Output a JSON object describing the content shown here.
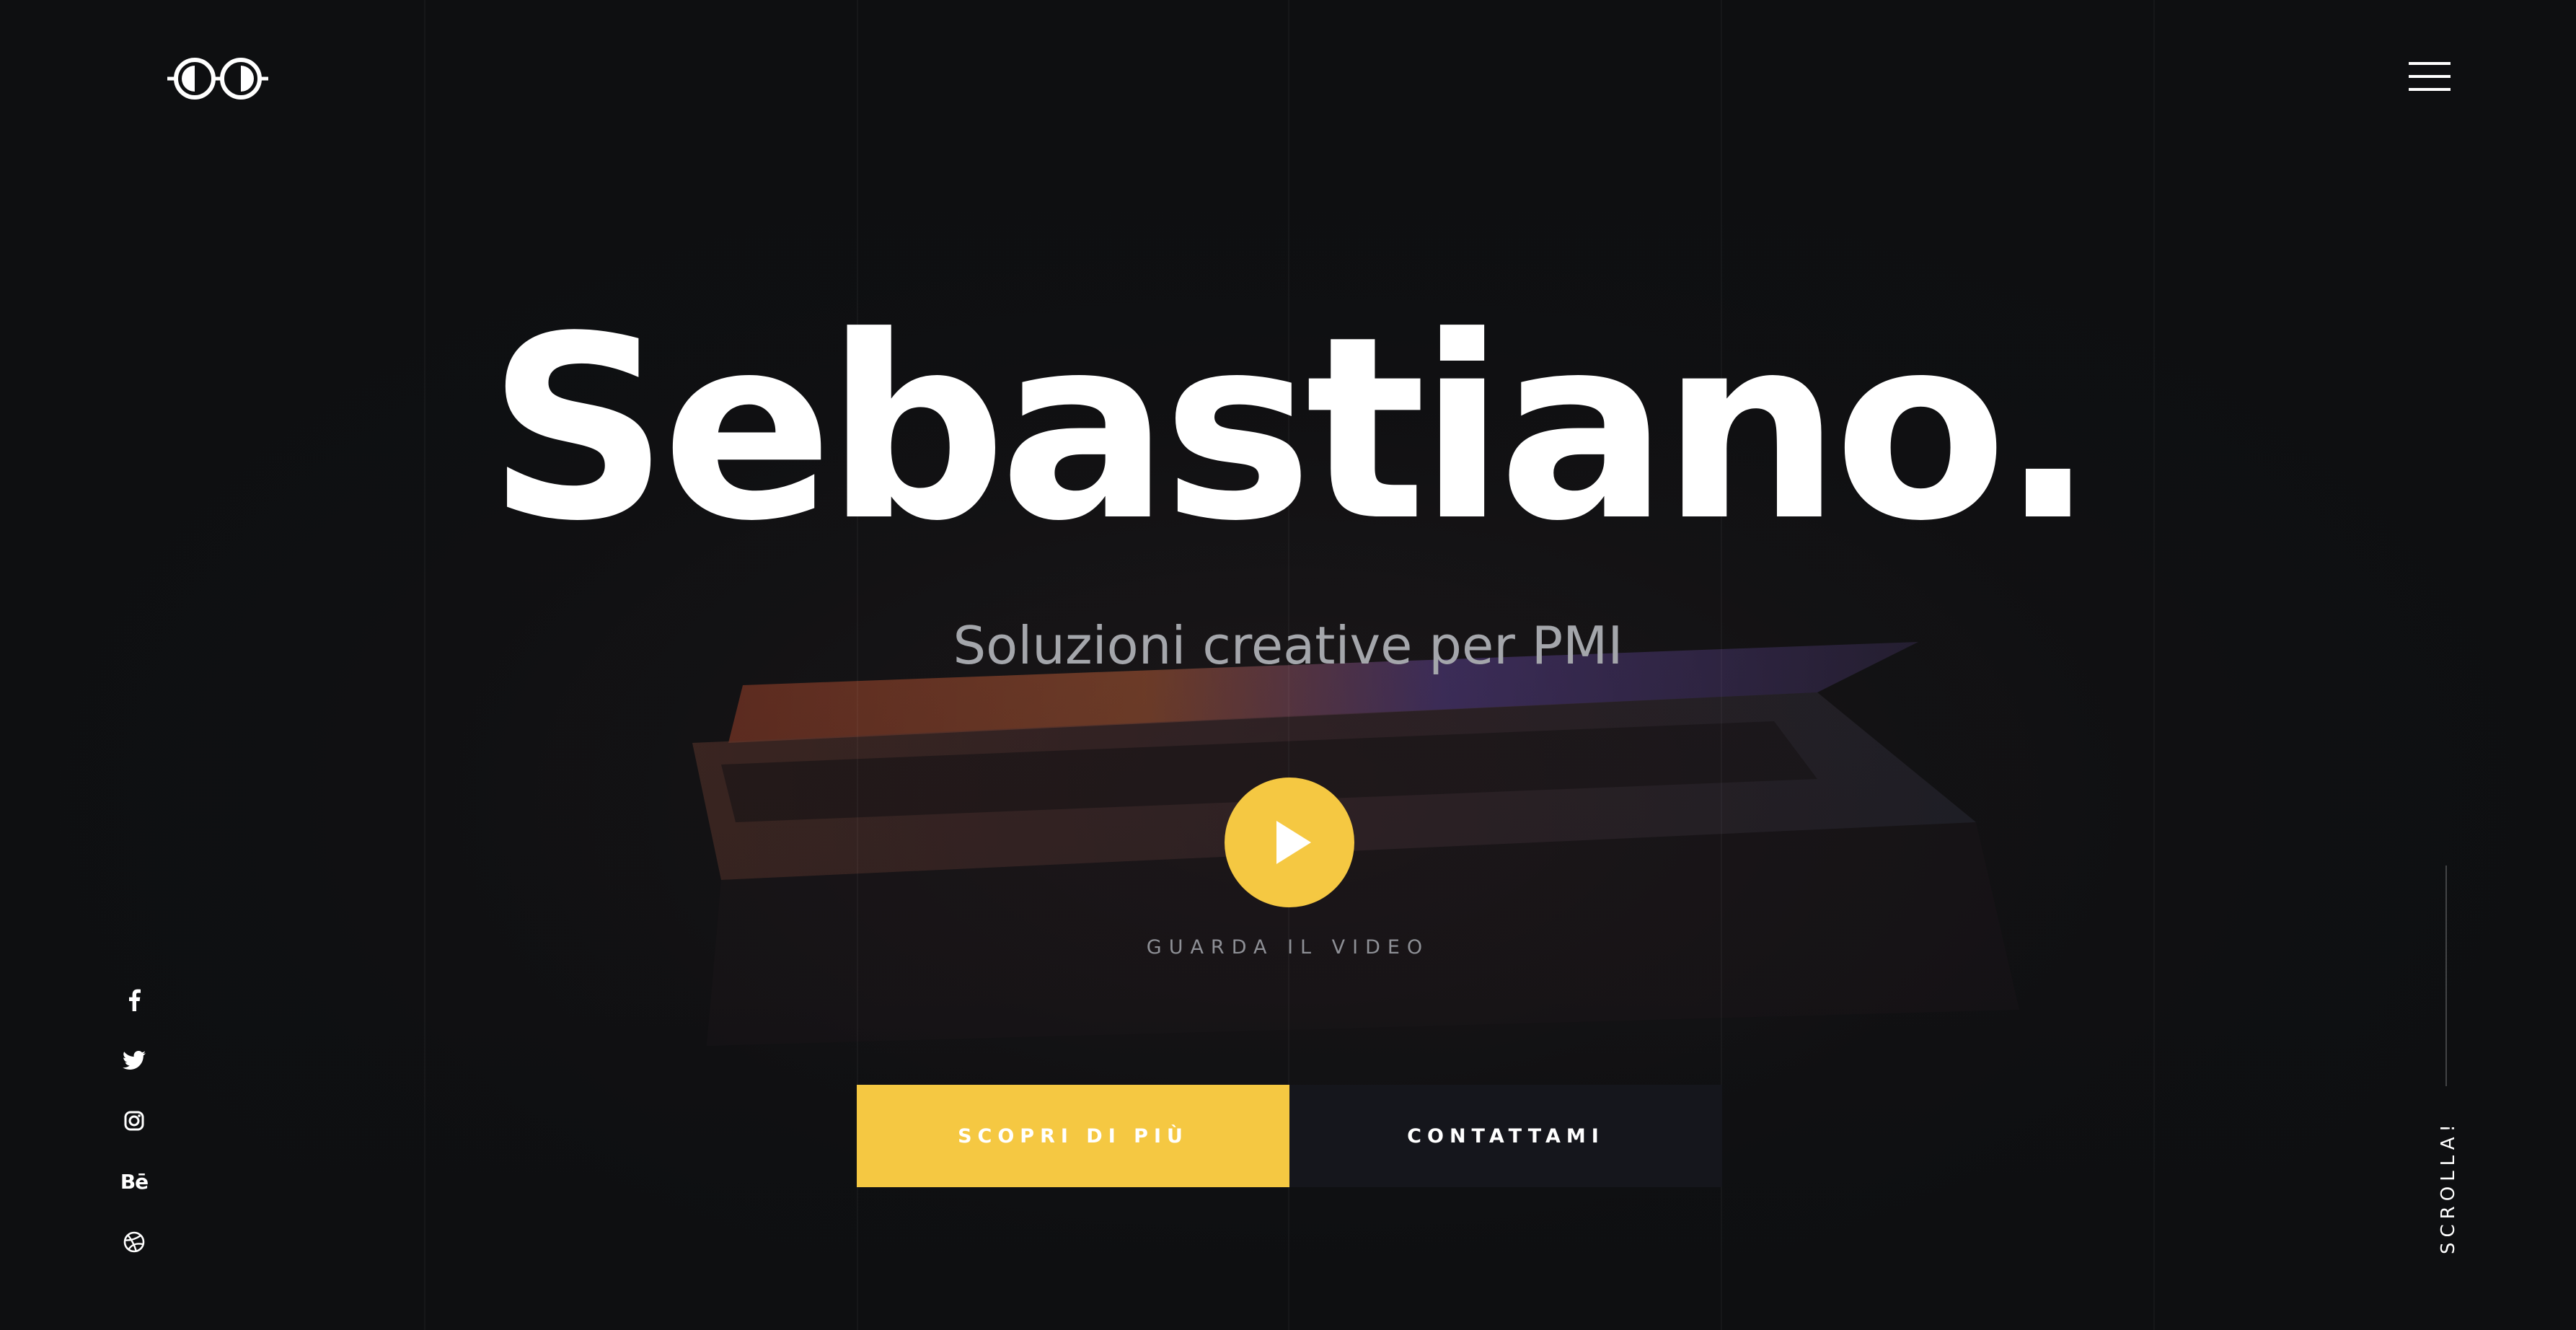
{
  "brand": {
    "logo_icon": "glasses-logo-icon"
  },
  "header": {
    "menu_icon": "hamburger-menu-icon"
  },
  "hero": {
    "title": "Sebastiano.",
    "subtitle": "Soluzioni creative per PMI",
    "background_icon": "laptop-photo",
    "play_icon": "play-icon",
    "video_label": "GUARDA IL VIDEO",
    "primary_cta": "SCOPRI DI PIÙ",
    "secondary_cta": "CONTATTAMI"
  },
  "social": [
    {
      "name": "facebook",
      "icon": "facebook-icon"
    },
    {
      "name": "twitter",
      "icon": "twitter-icon"
    },
    {
      "name": "instagram",
      "icon": "instagram-icon"
    },
    {
      "name": "behance",
      "icon": "behance-icon",
      "label": "Bē"
    },
    {
      "name": "dribbble",
      "icon": "dribbble-icon"
    }
  ],
  "scroll": {
    "label": "SCROLLA!"
  },
  "colors": {
    "background": "#0e0f11",
    "accent": "#f5c842",
    "secondary_button": "#15161c",
    "text": "#ffffff",
    "muted_text": "#a4a6ab"
  }
}
